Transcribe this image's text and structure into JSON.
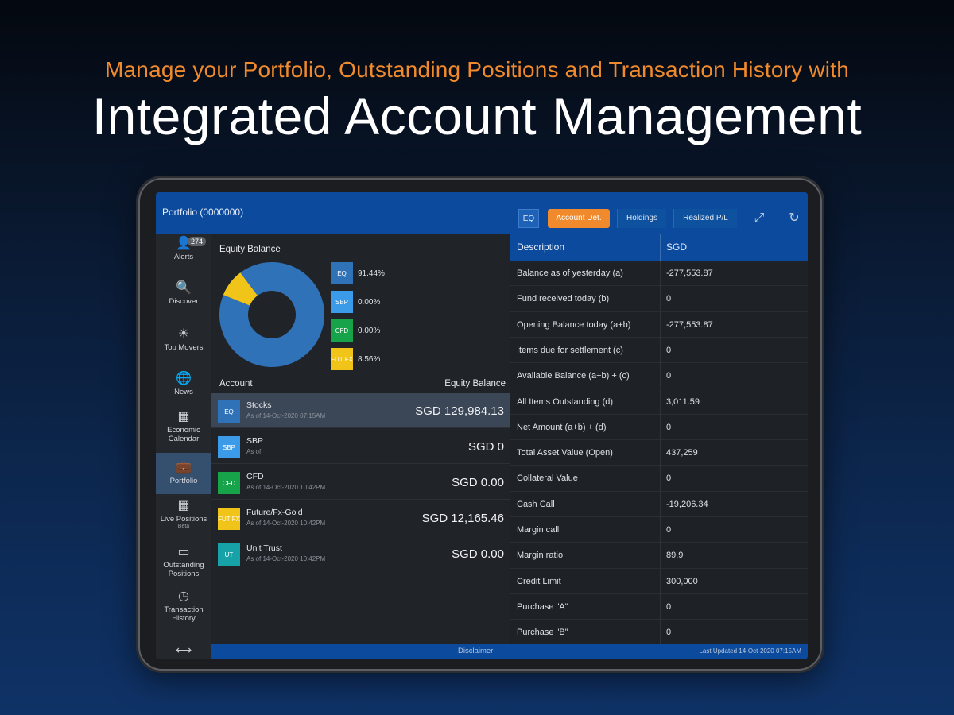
{
  "headline": {
    "sub": "Manage your Portfolio, Outstanding Positions and Transaction History with",
    "main": "Integrated Account Management"
  },
  "app": {
    "title": "Portfolio (0000000)",
    "toolbar": {
      "eq_label": "EQ",
      "tabs": [
        "Account Det.",
        "Holdings",
        "Realized P/L"
      ],
      "active_tab": "Account Det.",
      "icons": [
        "expand-icon",
        "refresh-icon"
      ]
    },
    "sidebar": {
      "alerts_badge": "274",
      "items": [
        {
          "label": "Alerts",
          "icon": "bell-icon"
        },
        {
          "label": "Discover",
          "icon": "search-icon"
        },
        {
          "label": "Top Movers",
          "icon": "lightbulb-icon"
        },
        {
          "label": "News",
          "icon": "globe-icon"
        },
        {
          "label": "Economic Calendar",
          "icon": "calendar-icon"
        },
        {
          "label": "Portfolio",
          "icon": "briefcase-icon"
        },
        {
          "label": "Live Positions",
          "sub": "Beta",
          "icon": "grid-icon"
        },
        {
          "label": "Outstanding Positions",
          "icon": "tag-icon"
        },
        {
          "label": "Transaction History",
          "icon": "clock-icon"
        }
      ],
      "active": "Portfolio",
      "bottom_icon": "expand-horizontal-icon"
    },
    "equity": {
      "title": "Equity Balance",
      "legend": [
        {
          "label": "EQ",
          "value": "91.44%",
          "color": "#2f72b8"
        },
        {
          "label": "SBP",
          "value": "0.00%",
          "color": "#3b9be8"
        },
        {
          "label": "CFD",
          "value": "0.00%",
          "color": "#16a34a"
        },
        {
          "label": "FUT FX",
          "value": "8.56%",
          "color": "#f0c419"
        }
      ],
      "donut_fractions": [
        0.9144,
        0.0856
      ],
      "donut_colors": [
        "#2f72b8",
        "#f0c419"
      ]
    },
    "accounts": {
      "header": {
        "account": "Account",
        "balance": "Equity Balance"
      },
      "rows": [
        {
          "code": "EQ",
          "name": "Stocks",
          "asof": "As of 14-Oct-2020 07:15AM",
          "balance": "SGD 129,984.13",
          "color": "#2f72b8",
          "selected": true
        },
        {
          "code": "SBP",
          "name": "SBP",
          "asof": "As of",
          "balance": "SGD 0",
          "color": "#3b9be8",
          "selected": false
        },
        {
          "code": "CFD",
          "name": "CFD",
          "asof": "As of 14-Oct-2020 10:42PM",
          "balance": "SGD 0.00",
          "color": "#16a34a",
          "selected": false
        },
        {
          "code": "FUT FX",
          "name": "Future/Fx-Gold",
          "asof": "As of 14-Oct-2020 10:42PM",
          "balance": "SGD 12,165.46",
          "color": "#f0c419",
          "selected": false
        },
        {
          "code": "UT",
          "name": "Unit Trust",
          "asof": "As of 14-Oct-2020 10:42PM",
          "balance": "SGD 0.00",
          "color": "#17a2a8",
          "selected": false
        }
      ]
    },
    "details": {
      "header": {
        "description": "Description",
        "currency": "SGD"
      },
      "rows": [
        {
          "label": "Balance as of yesterday (a)",
          "value": "-277,553.87"
        },
        {
          "label": "Fund received today (b)",
          "value": "0"
        },
        {
          "label": "Opening Balance today (a+b)",
          "value": "-277,553.87"
        },
        {
          "label": "Items due for settlement (c)",
          "value": "0"
        },
        {
          "label": "Available Balance (a+b) + (c)",
          "value": "0"
        },
        {
          "label": "All Items Outstanding (d)",
          "value": "3,011.59"
        },
        {
          "label": "Net Amount (a+b) + (d)",
          "value": "0"
        },
        {
          "label": "Total Asset Value (Open)",
          "value": "437,259"
        },
        {
          "label": "Collateral Value",
          "value": "0"
        },
        {
          "label": "Cash Call",
          "value": "-19,206.34"
        },
        {
          "label": "Margin call",
          "value": "0"
        },
        {
          "label": "Margin ratio",
          "value": "89.9"
        },
        {
          "label": "Credit Limit",
          "value": "300,000"
        },
        {
          "label": "Purchase \"A\"",
          "value": "0"
        },
        {
          "label": "Purchase \"B\"",
          "value": "0"
        }
      ]
    },
    "footer": {
      "disclaimer": "Disclaimer",
      "last_updated": "Last Updated 14-Oct-2020 07:15AM"
    }
  }
}
